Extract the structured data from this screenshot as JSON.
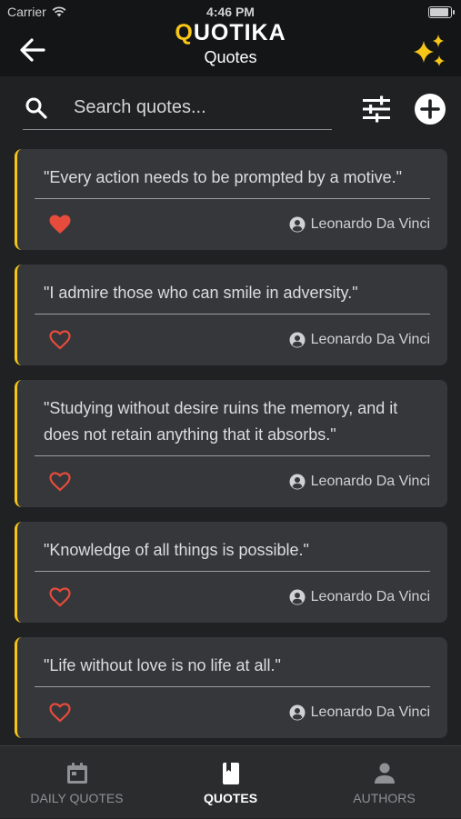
{
  "status_bar": {
    "carrier": "Carrier",
    "time": "4:46 PM",
    "battery_level": 1.0
  },
  "header": {
    "title_first_letter": "Q",
    "title_rest": "UOTIKA",
    "subtitle": "Quotes",
    "back_icon": "arrow-left-icon",
    "sparkle_icon": "sparkles-icon"
  },
  "search": {
    "placeholder": "Search quotes...",
    "value": "",
    "filter_icon": "sliders-icon",
    "add_icon": "plus-circle-icon"
  },
  "colors": {
    "accent": "#f5c518",
    "heart": "#e64b3c",
    "card": "#35373a",
    "background": "#1f2123",
    "bar": "#141516"
  },
  "quotes": [
    {
      "text": "\"Every action needs to be prompted by a motive.\"",
      "author": "Leonardo Da Vinci",
      "liked": true
    },
    {
      "text": "\"I admire those who can smile in adversity.\"",
      "author": "Leonardo Da Vinci",
      "liked": false
    },
    {
      "text": "\"Studying without desire ruins the memory, and it does not retain anything that it absorbs.\"",
      "author": "Leonardo Da Vinci",
      "liked": false
    },
    {
      "text": "\"Knowledge of all things is possible.\"",
      "author": "Leonardo Da Vinci",
      "liked": false
    },
    {
      "text": "\"Life without love is no life at all.\"",
      "author": "Leonardo Da Vinci",
      "liked": false
    }
  ],
  "tabs": [
    {
      "label": "DAILY QUOTES",
      "icon": "calendar-icon",
      "active": false
    },
    {
      "label": "QUOTES",
      "icon": "book-icon",
      "active": true
    },
    {
      "label": "AUTHORS",
      "icon": "person-icon",
      "active": false
    }
  ]
}
